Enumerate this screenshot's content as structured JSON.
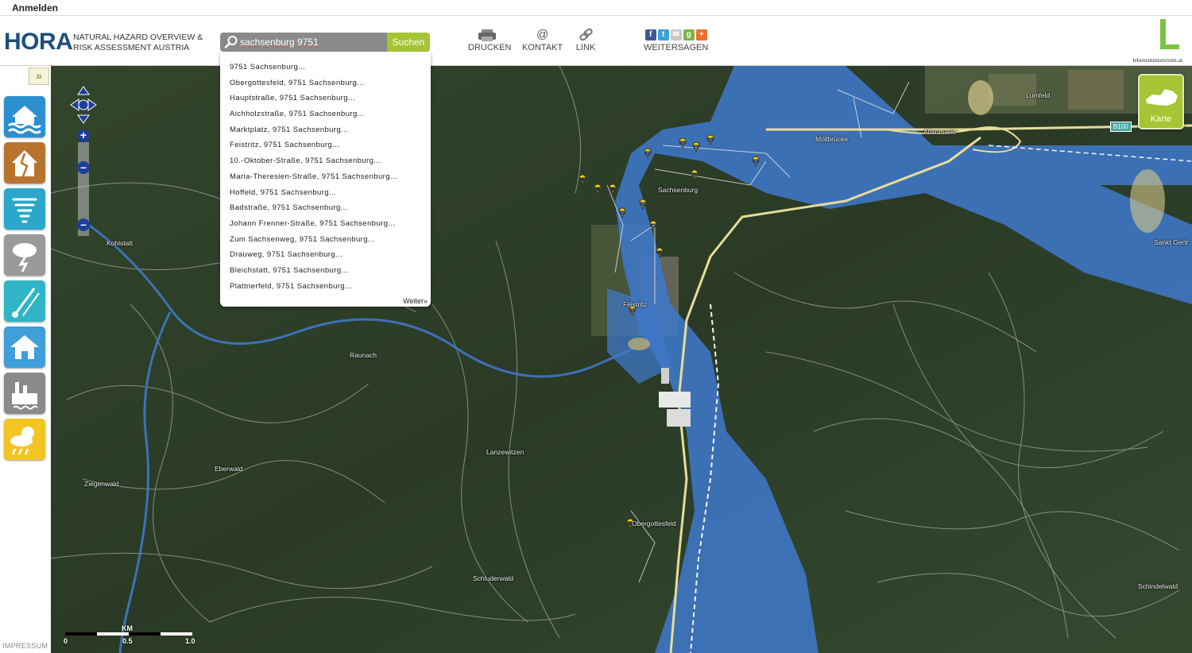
{
  "topbar": {
    "login": "Anmelden"
  },
  "logo": {
    "title": "HORA",
    "subtitle_line1": "NATURAL HAZARD OVERVIEW &",
    "subtitle_line2": "RISK ASSESSMENT AUSTRIA"
  },
  "search": {
    "value": "sachsenburg 9751",
    "button": "Suchen"
  },
  "tools": {
    "print": "DRUCKEN",
    "contact": "KONTAKT",
    "link": "LINK",
    "share": "WEITERSAGEN"
  },
  "ministry_logo": "lebensministerium.at",
  "sidebar": {
    "hazards": [
      {
        "icon": "flood-icon",
        "color": "#2b8fd0"
      },
      {
        "icon": "earthquake-house-icon",
        "color": "#b8742f"
      },
      {
        "icon": "storm-icon",
        "color": "#2aa7c9"
      },
      {
        "icon": "thunderstorm-icon",
        "color": "#9a9a9a"
      },
      {
        "icon": "hail-icon",
        "color": "#2fb5c6"
      },
      {
        "icon": "snow-load-house-icon",
        "color": "#3e9fd9"
      },
      {
        "icon": "factory-icon",
        "color": "#8a8a8a"
      },
      {
        "icon": "climate-sun-rain-icon",
        "color": "#f2c523"
      }
    ],
    "impressum": "IMPRESSUM"
  },
  "dropdown": {
    "suggestions": [
      "9751 Sachsenburg...",
      "Obergottesfeld, 9751 Sachsenburg...",
      "Hauptstraße, 9751 Sachsenburg...",
      "Aichholzstraße, 9751 Sachsenburg...",
      "Marktplatz, 9751 Sachsenburg...",
      "Feistritz, 9751 Sachsenburg...",
      "10.-Oktober-Straße, 9751 Sachsenburg...",
      "Maria-Theresien-Straße, 9751 Sachsenburg...",
      "Hoffeld, 9751 Sachsenburg...",
      "Badstraße, 9751 Sachsenburg...",
      "Johann Frenner-Straße, 9751 Sachsenburg...",
      "Zum Sachsenweg, 9751 Sachsenburg...",
      "Drauweg, 9751 Sachsenburg...",
      "Bleichstatt, 9751 Sachsenburg...",
      "Plattnerfeld, 9751 Sachsenburg..."
    ],
    "more": "Weiter»"
  },
  "map": {
    "places": [
      "Kohlstatt",
      "Raunach",
      "Sachsenburg",
      "Möllbrücke",
      "Altenmarkt",
      "Lumfeld",
      "Sankt Gertr",
      "Feistritz",
      "Lanzewitzen",
      "Eberwald",
      "Ziegenwald",
      "Obergottesfeld",
      "Schluderwald",
      "Schindelwald"
    ],
    "road_label": "B100",
    "karte_button": "Karte",
    "flood_color": "#3f78c8",
    "marker_color": "#f5d20a"
  },
  "scale": {
    "unit": "KM",
    "labels": [
      "0",
      "0.5",
      "1.0"
    ]
  }
}
